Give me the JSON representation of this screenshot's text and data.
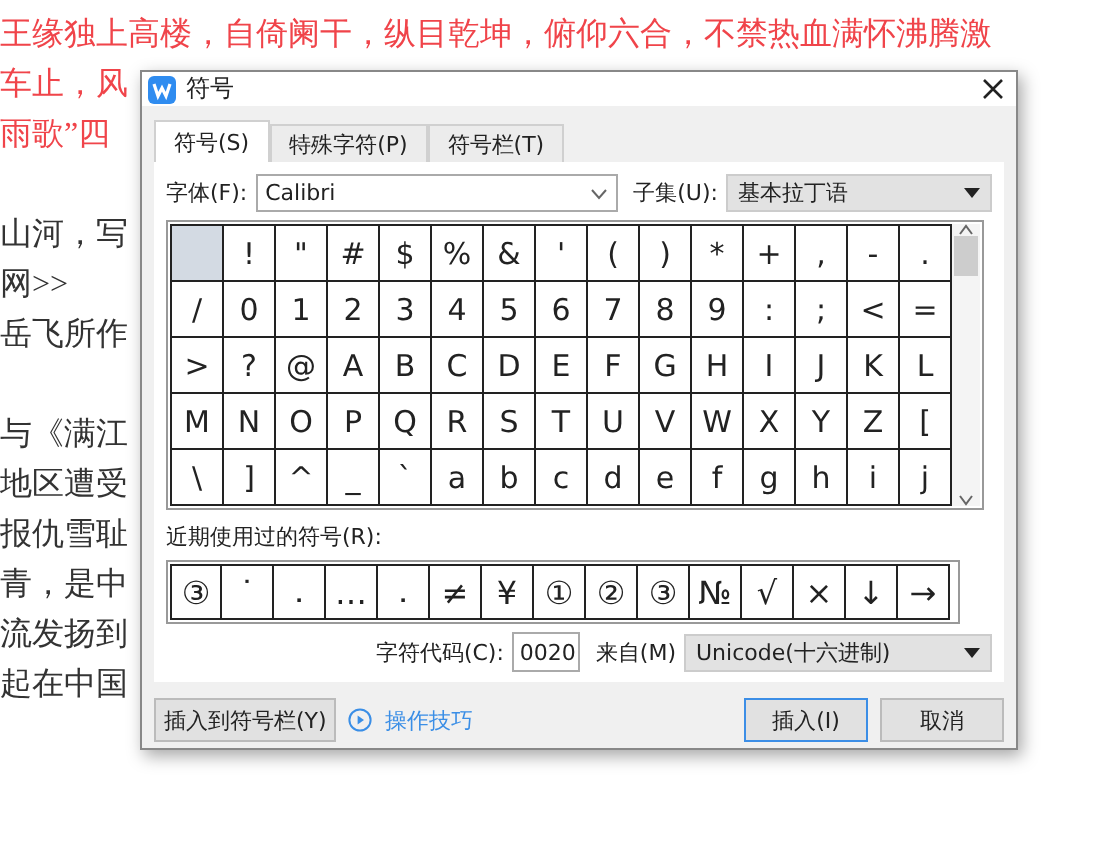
{
  "document": {
    "paragraphs": [
      [
        {
          "parts": [
            {
              "text": "王缘独上高楼，自倚阑干，纵目乾坤，俯仰六合，不禁热血满怀沸腾激",
              "kind": "red"
            }
          ]
        },
        {
          "parts": [
            {
              "text": "车止，风",
              "kind": "red"
            }
          ]
        },
        {
          "parts": [
            {
              "text": "雨歌”四",
              "kind": "red"
            }
          ]
        }
      ],
      [
        {
          "parts": [
            {
              "text": "山河，写",
              "kind": "black"
            }
          ]
        },
        {
          "parts": [
            {
              "text": "网>>",
              "kind": "black"
            }
          ]
        },
        {
          "parts": [
            {
              "text": "岳飞所作",
              "kind": "black"
            }
          ]
        }
      ],
      [
        {
          "parts": [
            {
              "text": "与《满江",
              "kind": "black"
            }
          ]
        },
        {
          "parts": [
            {
              "text": "地区遭受",
              "kind": "black"
            }
          ]
        },
        {
          "parts": [
            {
              "text": "报仇雪耻",
              "kind": "black"
            }
          ]
        },
        {
          "parts": [
            {
              "text": "青，是中",
              "kind": "black"
            }
          ]
        },
        {
          "parts": [
            {
              "text": "流发扬到",
              "kind": "black"
            }
          ]
        },
        {
          "parts": [
            {
              "text": "起在中国",
              "kind": "black"
            }
          ]
        }
      ]
    ]
  },
  "dialog": {
    "title": "符号",
    "tabs": [
      {
        "label": "符号(S)",
        "selected": true
      },
      {
        "label": "特殊字符(P)",
        "selected": false
      },
      {
        "label": "符号栏(T)",
        "selected": false
      }
    ],
    "font": {
      "label": "字体(F):",
      "value": "Calibri"
    },
    "subset": {
      "label": "子集(U):",
      "value": "基本拉丁语"
    },
    "grid": [
      [
        {
          "selected": true
        },
        {
          "char": "!",
          "selected": false
        },
        {
          "char": "\"",
          "selected": false
        },
        {
          "char": "#",
          "selected": false
        },
        {
          "char": "$",
          "selected": false
        },
        {
          "char": "%",
          "selected": false
        },
        {
          "char": "&",
          "selected": false
        },
        {
          "char": "'",
          "selected": false
        },
        {
          "char": "(",
          "selected": false
        },
        {
          "char": ")",
          "selected": false
        },
        {
          "char": "*",
          "selected": false
        },
        {
          "char": "+",
          "selected": false
        },
        {
          "char": ",",
          "selected": false
        },
        {
          "char": "-",
          "selected": false
        },
        {
          "char": ".",
          "selected": false
        }
      ],
      [
        {
          "char": "/",
          "selected": false
        },
        {
          "char": "0",
          "selected": false
        },
        {
          "char": "1",
          "selected": false
        },
        {
          "char": "2",
          "selected": false
        },
        {
          "char": "3",
          "selected": false
        },
        {
          "char": "4",
          "selected": false
        },
        {
          "char": "5",
          "selected": false
        },
        {
          "char": "6",
          "selected": false
        },
        {
          "char": "7",
          "selected": false
        },
        {
          "char": "8",
          "selected": false
        },
        {
          "char": "9",
          "selected": false
        },
        {
          "char": ":",
          "selected": false
        },
        {
          "char": ";",
          "selected": false
        },
        {
          "char": "<",
          "selected": false
        },
        {
          "char": "=",
          "selected": false
        }
      ],
      [
        {
          "char": ">",
          "selected": false
        },
        {
          "char": "?",
          "selected": false
        },
        {
          "char": "@",
          "selected": false
        },
        {
          "char": "A",
          "selected": false
        },
        {
          "char": "B",
          "selected": false
        },
        {
          "char": "C",
          "selected": false
        },
        {
          "char": "D",
          "selected": false
        },
        {
          "char": "E",
          "selected": false
        },
        {
          "char": "F",
          "selected": false
        },
        {
          "char": "G",
          "selected": false
        },
        {
          "char": "H",
          "selected": false
        },
        {
          "char": "I",
          "selected": false
        },
        {
          "char": "J",
          "selected": false
        },
        {
          "char": "K",
          "selected": false
        },
        {
          "char": "L",
          "selected": false
        }
      ],
      [
        {
          "char": "M",
          "selected": false
        },
        {
          "char": "N",
          "selected": false
        },
        {
          "char": "O",
          "selected": false
        },
        {
          "char": "P",
          "selected": false
        },
        {
          "char": "Q",
          "selected": false
        },
        {
          "char": "R",
          "selected": false
        },
        {
          "char": "S",
          "selected": false
        },
        {
          "char": "T",
          "selected": false
        },
        {
          "char": "U",
          "selected": false
        },
        {
          "char": "V",
          "selected": false
        },
        {
          "char": "W",
          "selected": false
        },
        {
          "char": "X",
          "selected": false
        },
        {
          "char": "Y",
          "selected": false
        },
        {
          "char": "Z",
          "selected": false
        },
        {
          "char": "[",
          "selected": false
        }
      ],
      [
        {
          "char": "\\",
          "selected": false
        },
        {
          "char": "]",
          "selected": false
        },
        {
          "char": "^",
          "selected": false
        },
        {
          "char": "_",
          "selected": false
        },
        {
          "char": "`",
          "selected": false
        },
        {
          "char": "a",
          "selected": false
        },
        {
          "char": "b",
          "selected": false
        },
        {
          "char": "c",
          "selected": false
        },
        {
          "char": "d",
          "selected": false
        },
        {
          "char": "e",
          "selected": false
        },
        {
          "char": "f",
          "selected": false
        },
        {
          "char": "g",
          "selected": false
        },
        {
          "char": "h",
          "selected": false
        },
        {
          "char": "i",
          "selected": false
        },
        {
          "char": "j",
          "selected": false
        }
      ]
    ],
    "recent_label": "近期使用过的符号(R):",
    "recent": [
      "③",
      "˙",
      "．",
      "…",
      "．",
      "≠",
      "¥",
      "①",
      "②",
      "③",
      "№",
      "√",
      "×",
      "↓",
      "→"
    ],
    "code": {
      "label": "字符代码(C):",
      "value": "0020"
    },
    "from": {
      "label": "来自(M)",
      "value": "Unicode(十六进制)"
    },
    "buttons": {
      "add_to_bar": "插入到符号栏(Y)",
      "tips": "操作技巧",
      "insert": "插入(I)",
      "cancel": "取消"
    }
  }
}
